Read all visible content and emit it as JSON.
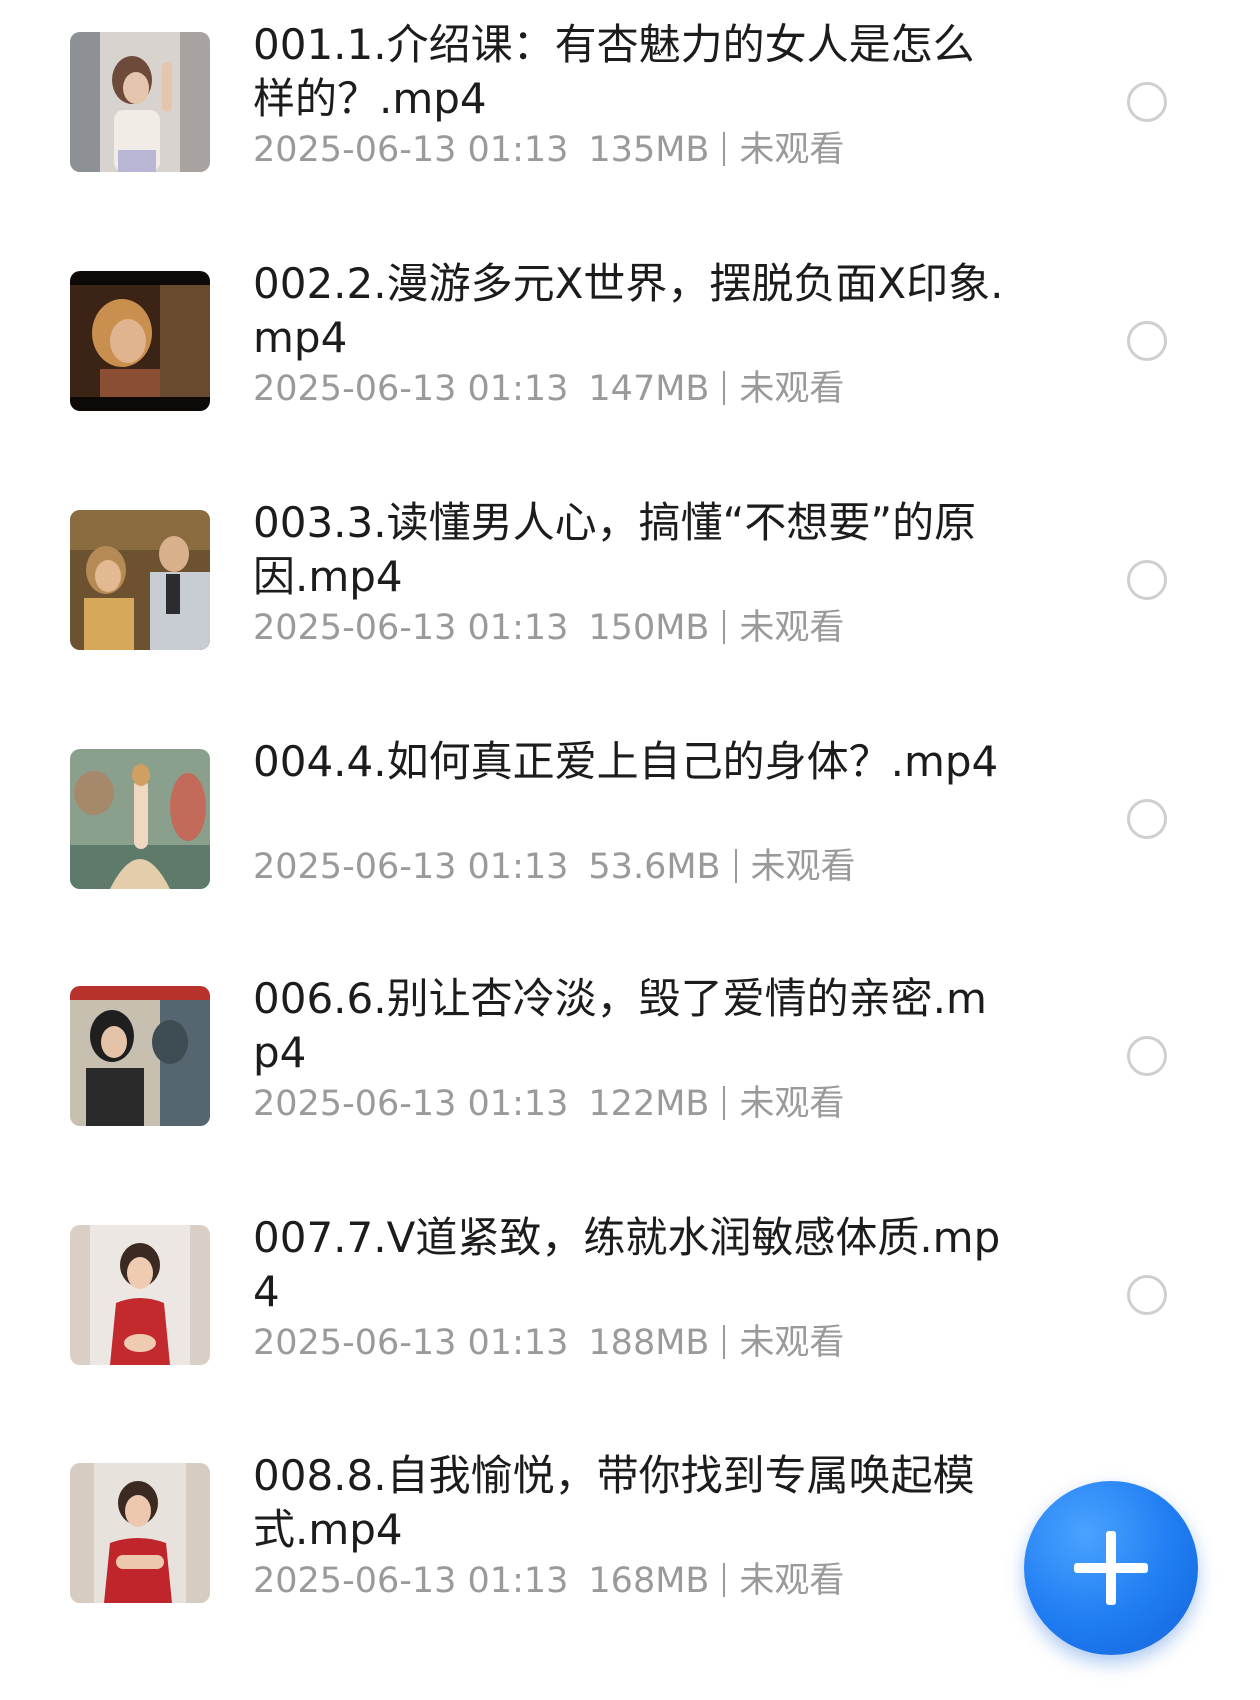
{
  "files": [
    {
      "title": "001.1.介绍课：有杏魅力的女人是怎么样的？.mp4",
      "date": "2025-06-13 01:13",
      "size": "135MB",
      "status": "未观看",
      "thumb_colors": [
        "#d9d3cf",
        "#b79a8c",
        "#6b6a70"
      ]
    },
    {
      "title": "002.2.漫游多元X世界，摆脱负面X印象.mp4",
      "date": "2025-06-13 01:13",
      "size": "147MB",
      "status": "未观看",
      "thumb_colors": [
        "#1a120c",
        "#c9925a",
        "#7a4a2a"
      ]
    },
    {
      "title": "003.3.读懂男人心，搞懂“不想要”的原因.mp4",
      "date": "2025-06-13 01:13",
      "size": "150MB",
      "status": "未观看",
      "thumb_colors": [
        "#7a5a2e",
        "#c8a870",
        "#3a3a40"
      ]
    },
    {
      "title": "004.4.如何真正爱上自己的身体？.mp4",
      "date": "2025-06-13 01:13",
      "size": "53.6MB",
      "status": "未观看",
      "thumb_colors": [
        "#5d7060",
        "#d8c4a0",
        "#c48f6a"
      ]
    },
    {
      "title": "006.6.别让杏冷淡，毁了爱情的亲密.mp4",
      "date": "2025-06-13 01:13",
      "size": "122MB",
      "status": "未观看",
      "thumb_colors": [
        "#c9c0b0",
        "#2a2a2a",
        "#556670"
      ]
    },
    {
      "title": "007.7.V道紧致，练就水润敏感体质.mp4",
      "date": "2025-06-13 01:13",
      "size": "188MB",
      "status": "未观看",
      "thumb_colors": [
        "#ede7e3",
        "#c32a2e",
        "#e9c7b2"
      ]
    },
    {
      "title": "008.8.自我愉悦，带你找到专属唤起模式.mp4",
      "date": "2025-06-13 01:13",
      "size": "168MB",
      "status": "未观看",
      "thumb_colors": [
        "#e8e2dc",
        "#c0252b",
        "#e7c5b0"
      ]
    }
  ],
  "fab": {
    "icon": "plus-icon",
    "color": "#1f7cf2"
  }
}
